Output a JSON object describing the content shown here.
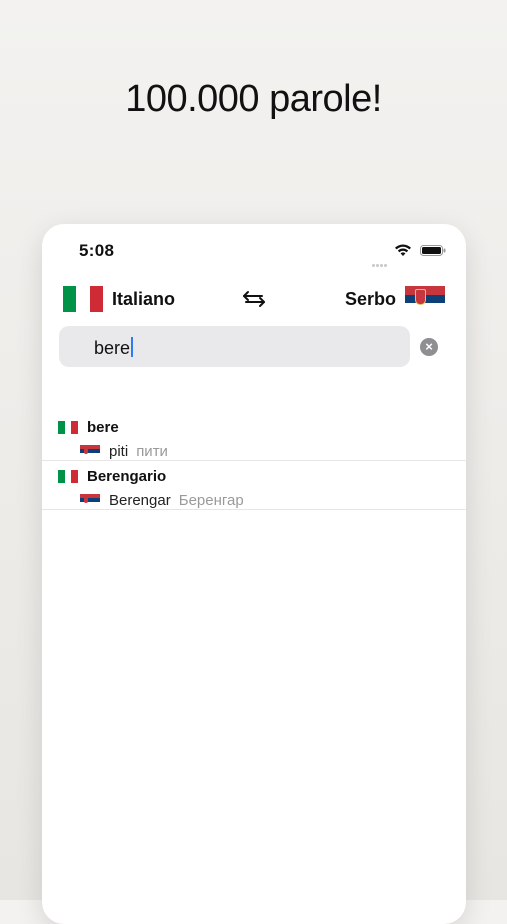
{
  "headline": "100.000 parole!",
  "status_bar": {
    "time": "5:08"
  },
  "languages": {
    "source": "Italiano",
    "target": "Serbo"
  },
  "search": {
    "query": "bere"
  },
  "results": [
    {
      "term": "bere",
      "translation": "piti",
      "cyrillic": "пити"
    },
    {
      "term": "Berengario",
      "translation": "Berengar",
      "cyrillic": "Беренгар"
    }
  ],
  "colors": {
    "italy": [
      "#009246",
      "#ffffff",
      "#ce2b37"
    ],
    "serbia": [
      "#c6363c",
      "#0c4076",
      "#ffffff"
    ],
    "caret": "#2f7bf6"
  },
  "icons": {
    "swap": "swap-arrows-icon",
    "clear": "clear-icon",
    "wifi": "wifi-icon",
    "battery": "battery-icon"
  }
}
